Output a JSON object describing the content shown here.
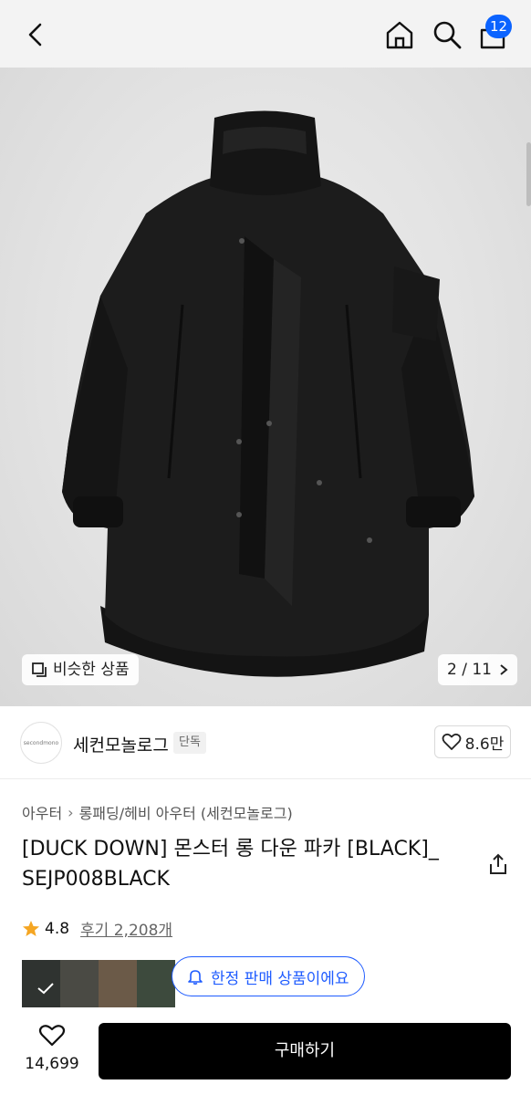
{
  "topbar": {
    "cart_count": "12"
  },
  "hero": {
    "similar_label": "비슷한 상품",
    "image_counter": "2 / 11"
  },
  "brand": {
    "logo_text": "secondmono",
    "name": "세컨모놀로그",
    "tag": "단독",
    "likes": "8.6만"
  },
  "breadcrumb": {
    "items": [
      "아우터",
      "롱패딩/헤비 아우터 (세컨모놀로그)"
    ]
  },
  "product": {
    "title": "[DUCK DOWN] 몬스터 롱 다운 파카 [BLACK]_ SEJP008BLACK",
    "rating": "4.8",
    "reviews": "후기 2,208개"
  },
  "limited_badge": "한정 판매 상품이에요",
  "bottom": {
    "wish_count": "14,699",
    "buy_label": "구매하기"
  },
  "colors": {
    "accent": "#1f5cff",
    "badge": "#0b63ff",
    "star": "#f5a623"
  }
}
